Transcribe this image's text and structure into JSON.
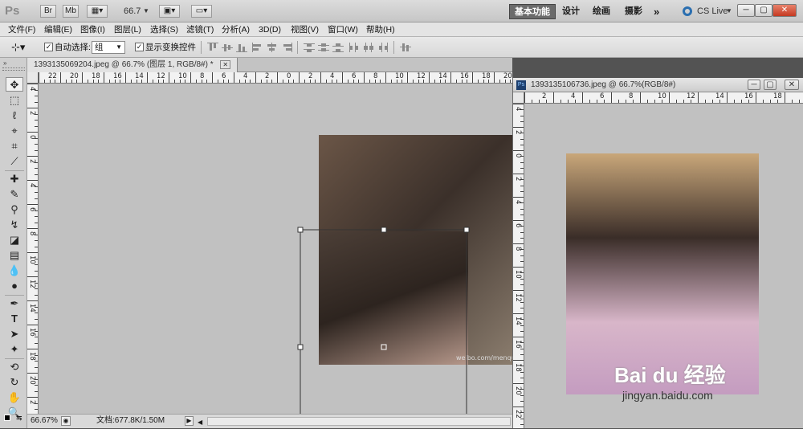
{
  "app": {
    "logo": "Ps",
    "bridge_btn": "Br",
    "minibridge_btn": "Mb",
    "zoom_value": "66.7",
    "workspaces": [
      "基本功能",
      "设计",
      "绘画",
      "摄影"
    ],
    "more_workspaces": "»",
    "cslive": "CS Live"
  },
  "menu": [
    "文件(F)",
    "编辑(E)",
    "图像(I)",
    "图层(L)",
    "选择(S)",
    "滤镜(T)",
    "分析(A)",
    "3D(D)",
    "视图(V)",
    "窗口(W)",
    "帮助(H)"
  ],
  "options": {
    "auto_select_label": "自动选择:",
    "auto_select_checked": true,
    "auto_select_value": "组",
    "show_transform_label": "显示变换控件",
    "show_transform_checked": true
  },
  "doc1": {
    "tab_title": "1393135069204.jpeg @ 66.7% (图层 1, RGB/8#) *",
    "zoom": "66.67%",
    "doc_info": "文档:677.8K/1.50M",
    "ruler_h": [
      "22",
      "20",
      "18",
      "16",
      "14",
      "12",
      "10",
      "8",
      "6",
      "4",
      "2",
      "0",
      "2",
      "4",
      "6",
      "8",
      "10",
      "12",
      "14",
      "16",
      "18",
      "20"
    ],
    "ruler_v": [
      "4",
      "2",
      "0",
      "2",
      "4",
      "6",
      "8",
      "10",
      "12",
      "14",
      "16",
      "18",
      "20",
      "2"
    ],
    "photo_bg": "#5a4a3e",
    "watermark": "weibo.com/menquan"
  },
  "doc2": {
    "title": "1393135106736.jpeg @ 66.7%(RGB/8#)",
    "ruler_h": [
      "2",
      "4",
      "6",
      "8",
      "10",
      "12",
      "14",
      "16",
      "18"
    ],
    "ruler_v": [
      "4",
      "2",
      "0",
      "2",
      "4",
      "6",
      "8",
      "10",
      "12",
      "14",
      "16",
      "18",
      "20",
      "22"
    ],
    "photo_bg": "#d9c6c0",
    "baidu_logo": "Bai du 经验",
    "baidu_url": "jingyan.baidu.com"
  },
  "icons": {
    "color_accent": "#6b6b6b"
  }
}
